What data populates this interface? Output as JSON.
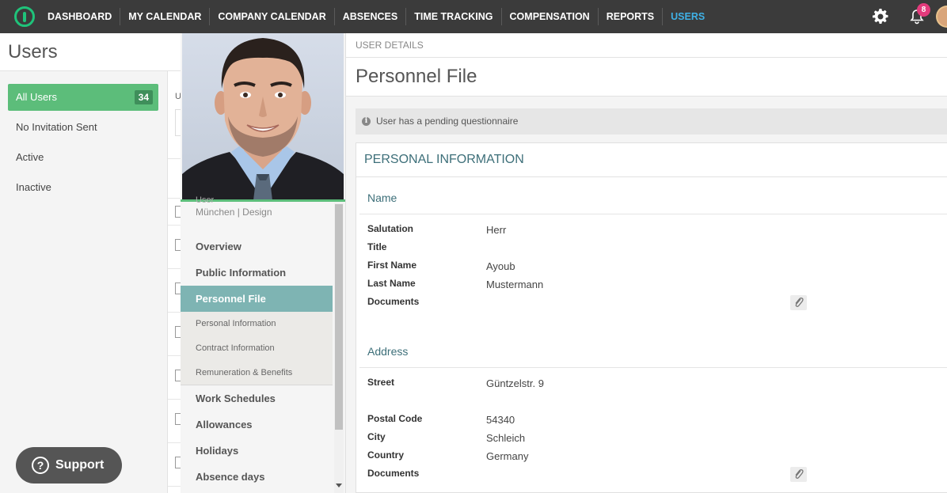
{
  "nav": {
    "items": [
      "DASHBOARD",
      "MY CALENDAR",
      "COMPANY CALENDAR",
      "ABSENCES",
      "TIME TRACKING",
      "COMPENSATION",
      "REPORTS",
      "USERS"
    ],
    "active": "USERS",
    "notification_count": "8"
  },
  "left": {
    "title": "Users",
    "filters": [
      {
        "label": "All Users",
        "count": "34"
      },
      {
        "label": "No Invitation Sent"
      },
      {
        "label": "Active"
      },
      {
        "label": "Inactive"
      }
    ]
  },
  "middle": {
    "partial_letter": "U"
  },
  "profile": {
    "role_partial": "User",
    "location": "München | Design",
    "menu": [
      "Overview",
      "Public Information",
      "Personnel File",
      "Work Schedules",
      "Allowances",
      "Holidays",
      "Absence days"
    ],
    "active_menu": "Personnel File",
    "submenu": [
      "Personal Information",
      "Contract Information",
      "Remuneration & Benefits"
    ]
  },
  "details": {
    "breadcrumb": "USER DETAILS",
    "title": "Personnel File",
    "notice": "User has a pending questionnaire",
    "card_title": "PERSONAL INFORMATION",
    "name_section": {
      "heading": "Name",
      "fields": [
        {
          "label": "Salutation",
          "value": "Herr"
        },
        {
          "label": "Title",
          "value": ""
        },
        {
          "label": "First Name",
          "value": "Ayoub"
        },
        {
          "label": "Last Name",
          "value": "Mustermann"
        },
        {
          "label": "Documents",
          "value": ""
        }
      ]
    },
    "address_section": {
      "heading": "Address",
      "fields": [
        {
          "label": "Street",
          "value": "Güntzelstr. 9"
        },
        {
          "label": "Postal Code",
          "value": "54340"
        },
        {
          "label": "City",
          "value": "Schleich"
        },
        {
          "label": "Country",
          "value": "Germany"
        },
        {
          "label": "Documents",
          "value": ""
        }
      ]
    }
  },
  "support": {
    "label": "Support"
  },
  "colors": {
    "accent_green": "#5cbd7a",
    "active_nav": "#3fb1e6",
    "teal_text": "#3d6f79",
    "active_menu_bg": "#7eb4b3",
    "badge": "#e33b7c"
  }
}
